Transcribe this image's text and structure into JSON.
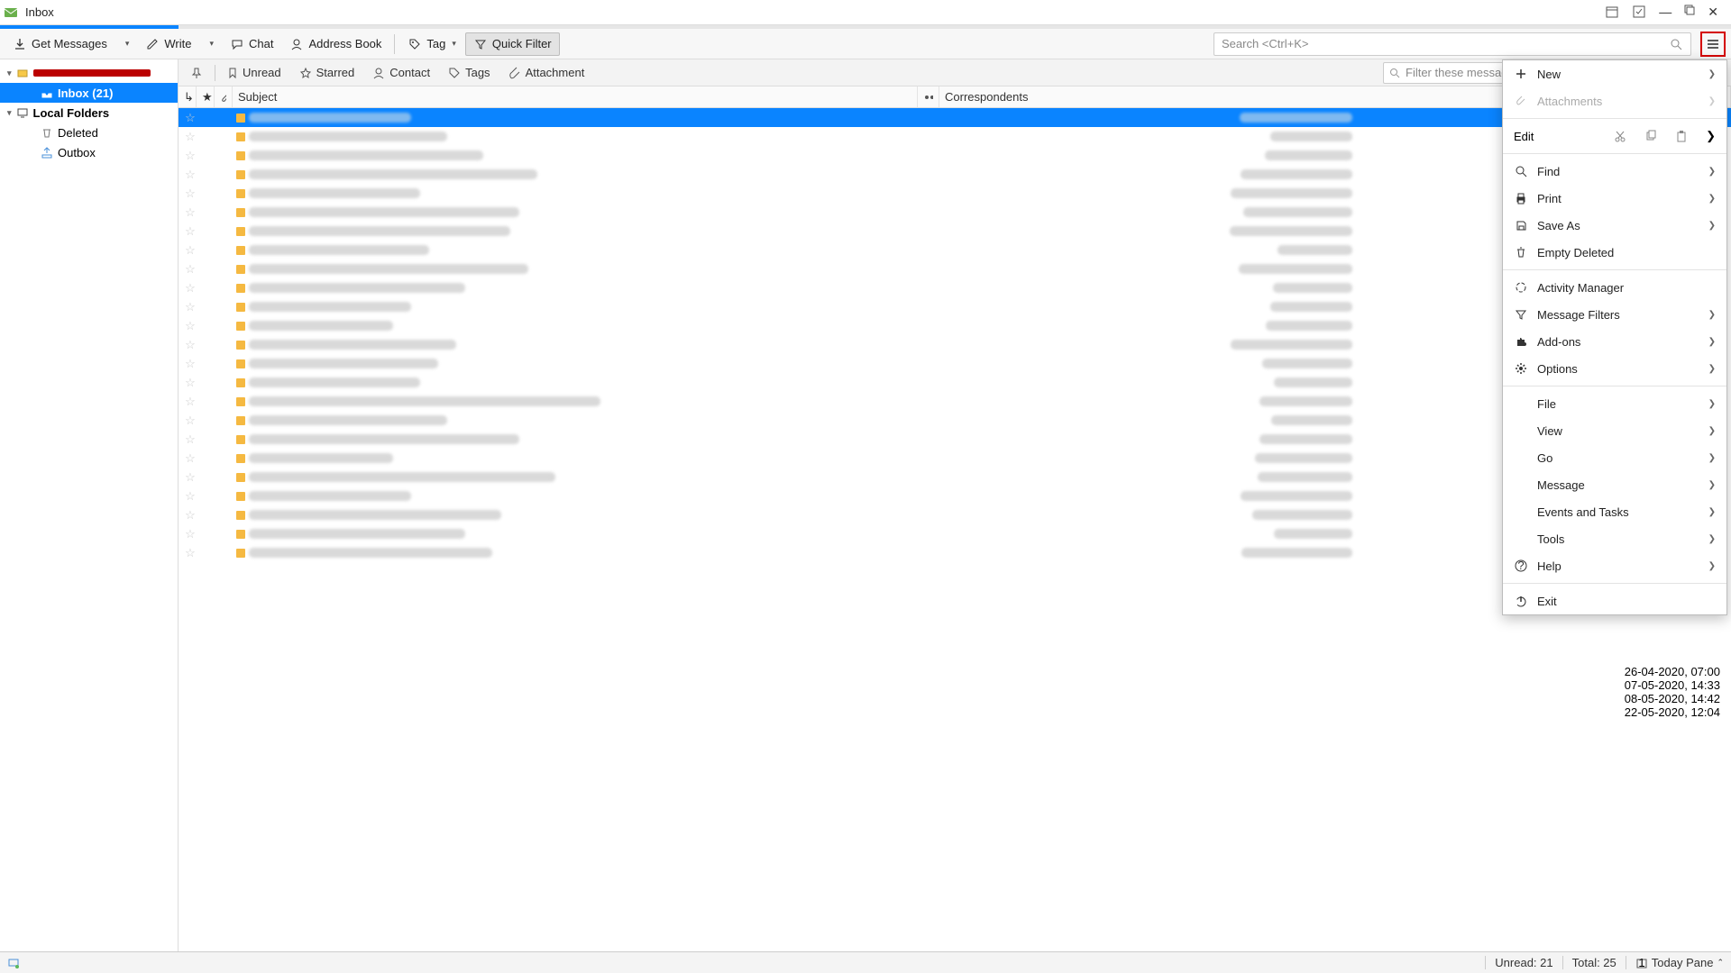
{
  "window": {
    "title": "Inbox"
  },
  "toolbar": {
    "get_messages": "Get Messages",
    "write": "Write",
    "chat": "Chat",
    "address_book": "Address Book",
    "tag": "Tag",
    "quick_filter": "Quick Filter",
    "search_placeholder": "Search <Ctrl+K>"
  },
  "folders": {
    "inbox": "Inbox (21)",
    "local": "Local Folders",
    "deleted": "Deleted",
    "outbox": "Outbox"
  },
  "filterbar": {
    "unread": "Unread",
    "starred": "Starred",
    "contact": "Contact",
    "tags": "Tags",
    "attachment": "Attachment",
    "filter_placeholder": "Filter these messages <Ctrl+Shift+K>"
  },
  "columns": {
    "subject": "Subject",
    "correspondents": "Correspondents"
  },
  "appmenu": {
    "new_": "New",
    "attachments": "Attachments",
    "edit": "Edit",
    "find": "Find",
    "print": "Print",
    "save_as": "Save As",
    "empty_deleted": "Empty Deleted",
    "activity_manager": "Activity Manager",
    "message_filters": "Message Filters",
    "addons": "Add-ons",
    "options": "Options",
    "file": "File",
    "view": "View",
    "go": "Go",
    "message": "Message",
    "events_tasks": "Events and Tasks",
    "tools": "Tools",
    "help": "Help",
    "exit": "Exit"
  },
  "today_pane": {
    "items": [
      {
        "text": "26-04-2020, 07:00",
        "bold": false
      },
      {
        "text": "07-05-2020, 14:33",
        "bold": true
      },
      {
        "text": "08-05-2020, 14:42",
        "bold": true
      },
      {
        "text": "22-05-2020, 12:04",
        "bold": true
      }
    ]
  },
  "status": {
    "unread": "Unread: 21",
    "total": "Total: 25",
    "today_pane": "Today Pane"
  }
}
